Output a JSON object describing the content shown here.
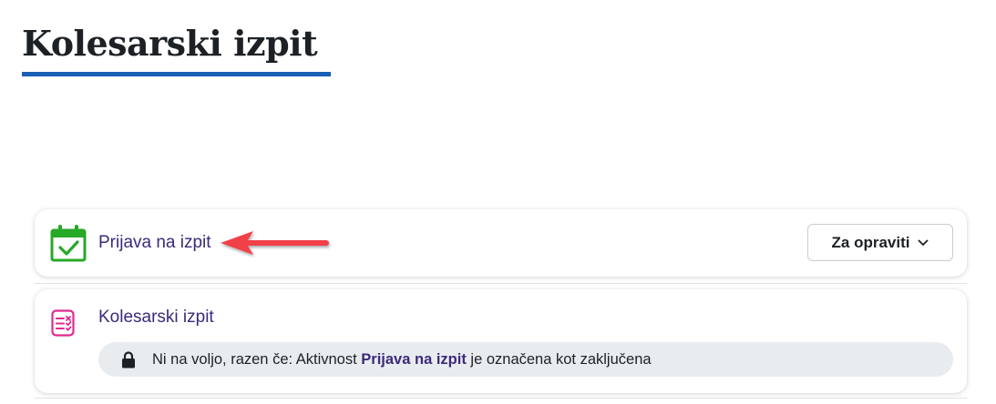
{
  "page": {
    "title": "Kolesarski izpit"
  },
  "activities": [
    {
      "name": "Prijava na izpit",
      "icon": "calendar-check-icon",
      "dropdown_label": "Za opraviti"
    },
    {
      "name": "Kolesarski izpit",
      "icon": "quiz-icon",
      "restriction": {
        "prefix": "Ni na voljo, razen če: Aktivnost ",
        "link": "Prijava na izpit",
        "suffix": " je označena kot zaključena"
      }
    }
  ],
  "colors": {
    "accent_underline": "#1a5fb4",
    "link": "#3c2a7a",
    "calendar_icon": "#27a827",
    "quiz_icon": "#e02a8e",
    "annotation_arrow": "#f2414a"
  }
}
